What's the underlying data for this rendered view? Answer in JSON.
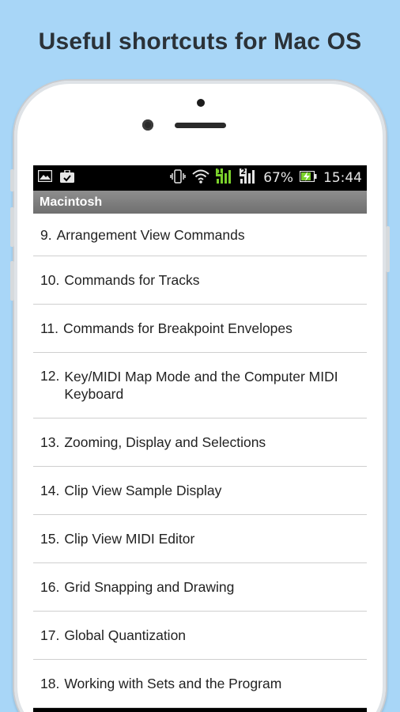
{
  "headline": "Useful shortcuts for Mac OS",
  "status": {
    "battery": "67%",
    "time": "15:44",
    "sim1": "1",
    "sim2": "2"
  },
  "app": {
    "title": "Macintosh"
  },
  "items": [
    {
      "num": "9.",
      "text": "Arrangement View Commands"
    },
    {
      "num": "10.",
      "text": "Commands for Tracks"
    },
    {
      "num": "11.",
      "text": "Commands for Breakpoint Envelopes"
    },
    {
      "num": "12.",
      "text": "Key/MIDI Map Mode and the Computer MIDI Keyboard"
    },
    {
      "num": "13.",
      "text": "Zooming, Display and Selections"
    },
    {
      "num": "14.",
      "text": "Clip View Sample Display"
    },
    {
      "num": "15.",
      "text": "Clip View MIDI Editor"
    },
    {
      "num": "16.",
      "text": "Grid Snapping and Drawing"
    },
    {
      "num": "17.",
      "text": "Global Quantization"
    },
    {
      "num": "18.",
      "text": "Working with Sets and the Program"
    }
  ],
  "colors": {
    "background": "#a8d6f7",
    "titlebar": "#7d7d7d",
    "battery": "#7bd12c"
  }
}
